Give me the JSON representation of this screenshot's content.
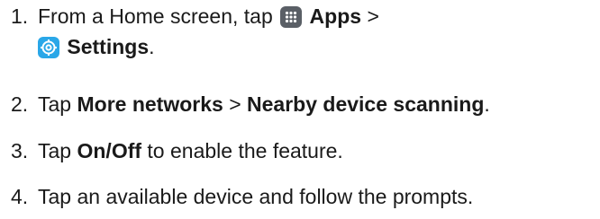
{
  "steps": [
    {
      "number": "1.",
      "parts": {
        "a": "From a Home screen, tap",
        "apps": "Apps",
        "sep": ">",
        "settings": "Settings",
        "end": "."
      },
      "icons": [
        "apps-icon",
        "settings-icon"
      ]
    },
    {
      "number": "2.",
      "parts": {
        "a": "Tap",
        "b1": "More networks",
        "sep": ">",
        "b2": "Nearby device scanning",
        "end": "."
      }
    },
    {
      "number": "3.",
      "parts": {
        "a": "Tap",
        "b1": "On/Off",
        "end": "to enable the feature."
      }
    },
    {
      "number": "4.",
      "parts": {
        "a": "Tap an available device and follow the prompts."
      }
    }
  ],
  "colors": {
    "text": "#1a1a1a",
    "apps_icon_bg": "#5a5f66",
    "settings_icon_bg": "#2aa7e8"
  }
}
